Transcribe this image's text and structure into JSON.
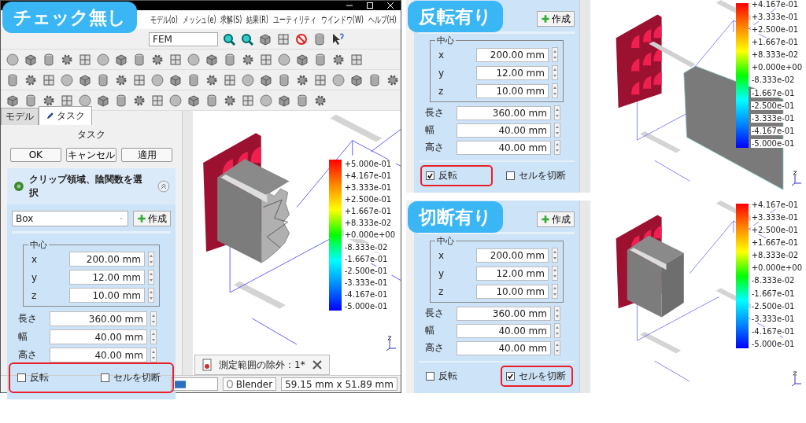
{
  "panels": [
    {
      "kind": "full",
      "badge": "チェック無し",
      "menu": [
        "モデル(o)",
        "メッシュ(e)",
        "求解(S)",
        "結果(R)",
        "ユーティリティ",
        "ウインドウ(W)",
        "ヘルプ(H)"
      ],
      "workbench": "FEM",
      "tabs": [
        {
          "label": "モデル",
          "selected": false
        },
        {
          "label": "タスク",
          "selected": true
        }
      ],
      "task_title": "タスク",
      "buttons": [
        "OK",
        "キャンセル",
        "適用"
      ],
      "section_title": "クリップ領域、陰関数を選択",
      "shape_combo": "Box",
      "create_button": "作成",
      "center_label": "中心",
      "center_fields": [
        {
          "label": "x",
          "value": "200.00 mm"
        },
        {
          "label": "y",
          "value": "12.00 mm"
        },
        {
          "label": "z",
          "value": "10.00 mm"
        }
      ],
      "size_fields": [
        {
          "label": "長さ",
          "value": "360.00 mm"
        },
        {
          "label": "幅",
          "value": "40.00 mm"
        },
        {
          "label": "高さ",
          "value": "40.00 mm"
        }
      ],
      "checkboxes": [
        {
          "label": "反転",
          "checked": false,
          "highlighted": true
        },
        {
          "label": "セルを切断",
          "checked": false,
          "highlighted": true
        }
      ],
      "legend": [
        "+5.000e-01",
        "+4.167e-01",
        "+3.333e-01",
        "+2.500e-01",
        "+1.667e-01",
        "+8.333e-02",
        "+0.000e+00",
        "-8.333e-02",
        "-1.667e-01",
        "-2.500e-01",
        "-3.333e-01",
        "-4.167e-01",
        "-5.000e-01"
      ],
      "notice": "測定範囲の除外：1*",
      "status_bar": {
        "navigation": "Blender",
        "dimensions": "59.15 mm x 51.89 mm"
      }
    },
    {
      "kind": "crop",
      "badge": "反転有り",
      "create_button": "作成",
      "center_label": "中心",
      "center_fields": [
        {
          "label": "x",
          "value": "200.00 mm"
        },
        {
          "label": "y",
          "value": "12.00 mm"
        },
        {
          "label": "z",
          "value": "10.00 mm"
        }
      ],
      "size_fields": [
        {
          "label": "長さ",
          "value": "360.00 mm"
        },
        {
          "label": "幅",
          "value": "40.00 mm"
        },
        {
          "label": "高さ",
          "value": "40.00 mm"
        }
      ],
      "checkboxes": [
        {
          "label": "反転",
          "checked": true,
          "highlighted": true
        },
        {
          "label": "セルを切断",
          "checked": false,
          "highlighted": false
        }
      ],
      "legend": [
        "+4.167e-01",
        "+3.333e-01",
        "+2.500e-01",
        "+1.667e-01",
        "+8.333e-02",
        "+0.000e+00",
        "-8.333e-02",
        "-1.667e-01",
        "-2.500e-01",
        "-3.333e-01",
        "-4.167e-01",
        "-5.000e-01"
      ]
    },
    {
      "kind": "crop",
      "badge": "切断有り",
      "create_button": "作成",
      "center_label": "中心",
      "center_fields": [
        {
          "label": "x",
          "value": "200.00 mm"
        },
        {
          "label": "y",
          "value": "12.00 mm"
        },
        {
          "label": "z",
          "value": "10.00 mm"
        }
      ],
      "size_fields": [
        {
          "label": "長さ",
          "value": "360.00 mm"
        },
        {
          "label": "幅",
          "value": "40.00 mm"
        },
        {
          "label": "高さ",
          "value": "40.00 mm"
        }
      ],
      "checkboxes": [
        {
          "label": "反転",
          "checked": false,
          "highlighted": false
        },
        {
          "label": "セルを切断",
          "checked": true,
          "highlighted": true
        }
      ],
      "legend": [
        "+4.167e-01",
        "+3.333e-01",
        "+2.500e-01",
        "+1.667e-01",
        "+8.333e-02",
        "+0.000e+00",
        "-8.333e-02",
        "-1.667e-01",
        "-2.500e-01",
        "-3.333e-01",
        "-4.167e-01",
        "-5.000e-01"
      ]
    }
  ]
}
